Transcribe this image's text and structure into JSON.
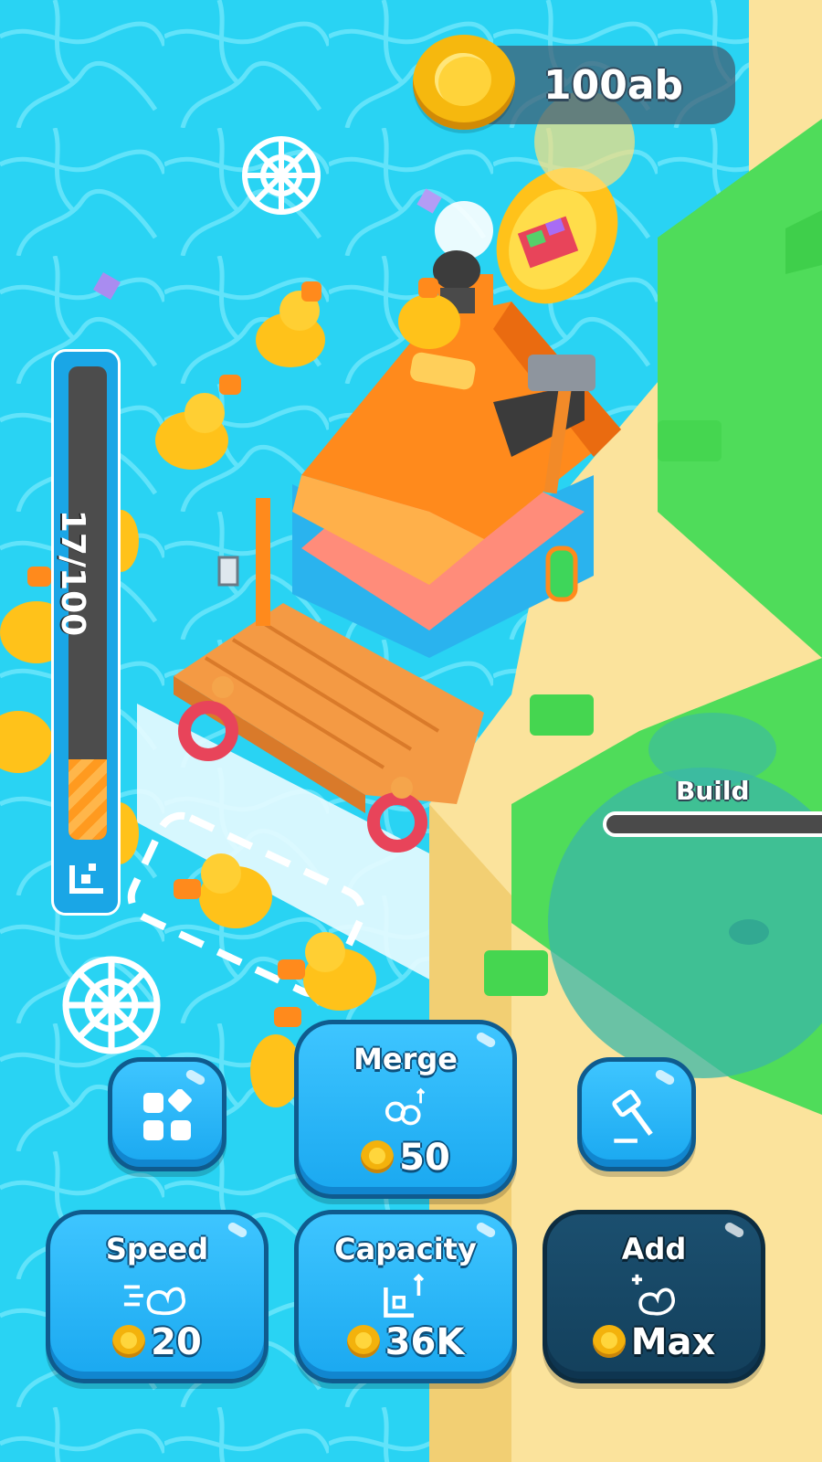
{
  "hud": {
    "coins": "100ab",
    "capacity_text": "17/100",
    "capacity_fraction": 0.17,
    "build_label": "Build",
    "build_progress": 0
  },
  "buttons": {
    "merge": {
      "label": "Merge",
      "price": "50",
      "icon": "ducks-merge-icon"
    },
    "speed": {
      "label": "Speed",
      "price": "20",
      "icon": "duck-speed-icon"
    },
    "capacity": {
      "label": "Capacity",
      "price": "36K",
      "icon": "box-capacity-icon"
    },
    "add": {
      "label": "Add",
      "price": "Max",
      "icon": "add-duck-icon"
    },
    "menu": {
      "icon": "grid-menu-icon"
    },
    "build": {
      "icon": "hammer-icon"
    }
  },
  "colors": {
    "water": "#29d3f3",
    "sand": "#fbe39c",
    "grass": "#4fdc5a",
    "button_blue": "#2bb7f8",
    "button_dark": "#164a68",
    "duck": "#ffc21a",
    "roof": "#ff8a1c"
  }
}
